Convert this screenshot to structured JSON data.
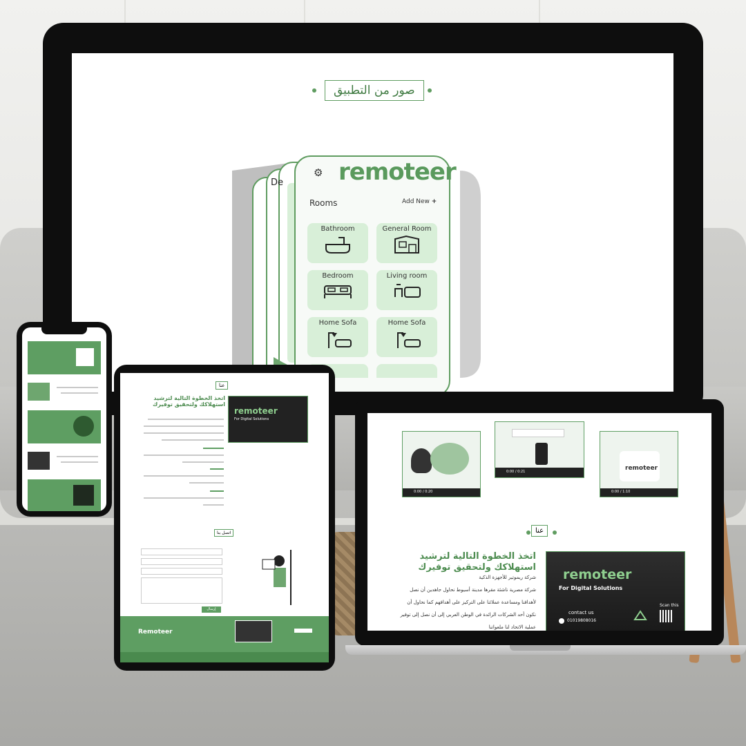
{
  "monitor": {
    "section_title": "صور من التطبيق",
    "app": {
      "logo": "remoteer",
      "rooms_heading": "Rooms",
      "add_new": "Add New",
      "stack_peek_label": "De",
      "rooms": [
        "Bathroom",
        "General Room",
        "Bedroom",
        "Living room",
        "Home Sofa",
        "Home Sofa"
      ],
      "icons": [
        "bathtub-icon",
        "room-icon",
        "bed-icon",
        "living-room-icon",
        "lamp-sofa-icon",
        "lamp-sofa-icon"
      ]
    }
  },
  "tablet": {
    "about_tag": "عنا",
    "headline": "اتخذ الخطوة التالية لترشيد استهلاكك ولتحقيق توفيرك",
    "contact_tag": "اتصل بنا",
    "submit": "إرسال",
    "footer_logo": "Remoteer"
  },
  "laptop": {
    "about_tag": "عنا",
    "headline": "اتخذ الخطوة التالية لترشيد استهلاكك ولتحقيق توفيرك",
    "company": "شركة ريموتير للأجهزة الذكية",
    "body_lines": [
      "شركة مصرية ناشئة مقرها مدينة أسيوط نحاول جاهدين أن نصل",
      "لأهدافنا ومساعدة عملائنا على التركيز على أهدافهم كما نحاول أن",
      "نكون أحد الشركات الرائدة في الوطن العربي إلى أن نصل إلى توفير",
      "عملية الاتحاد لنا ملعواتنا"
    ],
    "promo": {
      "logo": "remoteer",
      "tagline": "For Digital Solutions",
      "contact_label": "contact us",
      "phone": "01019808016",
      "scan_label": "Scan this"
    },
    "videos": [
      {
        "time": "0:00 / 0:20"
      },
      {
        "time": "0:00 / 0:21"
      },
      {
        "time": "0:00 / 1:10"
      }
    ]
  },
  "colors": {
    "brand_green": "#5e9e62",
    "dark_green": "#3f7a41",
    "tile_green": "#d8efd8"
  }
}
